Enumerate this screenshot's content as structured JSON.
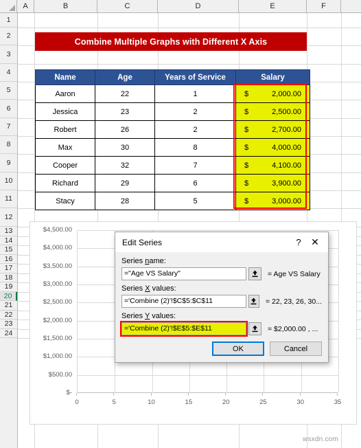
{
  "spreadsheet": {
    "column_headers": [
      "A",
      "B",
      "C",
      "D",
      "E",
      "F"
    ],
    "row_headers": [
      "1",
      "2",
      "3",
      "4",
      "5",
      "6",
      "7",
      "8",
      "9",
      "10",
      "11",
      "12",
      "13",
      "14",
      "15",
      "16",
      "17",
      "18",
      "19",
      "20",
      "21",
      "22",
      "23",
      "24"
    ],
    "selected_row": "20",
    "colors": {
      "header_fill": "#f0f0f0",
      "gridline": "#d8d8d8",
      "selection_green": "#0d7a42"
    }
  },
  "banner": {
    "text": "Combine Multiple Graphs with Different X Axis",
    "fill": "#c00000",
    "text_color": "#ffffff"
  },
  "table": {
    "headers": [
      "Name",
      "Age",
      "Years of Service",
      "Salary"
    ],
    "header_fill": "#2e5395",
    "highlight_fill": "#e8f000",
    "outline_color": "#ff0000",
    "currency_symbol": "$",
    "rows": [
      {
        "name": "Aaron",
        "age": "22",
        "years": "1",
        "salary": "2,000.00"
      },
      {
        "name": "Jessica",
        "age": "23",
        "years": "2",
        "salary": "2,500.00"
      },
      {
        "name": "Robert",
        "age": "26",
        "years": "2",
        "salary": "2,700.00"
      },
      {
        "name": "Max",
        "age": "30",
        "years": "8",
        "salary": "4,000.00"
      },
      {
        "name": "Cooper",
        "age": "32",
        "years": "7",
        "salary": "4,100.00"
      },
      {
        "name": "Richard",
        "age": "29",
        "years": "6",
        "salary": "3,900.00"
      },
      {
        "name": "Stacy",
        "age": "28",
        "years": "5",
        "salary": "3,000.00"
      }
    ]
  },
  "chart_data": {
    "type": "scatter",
    "title": "",
    "xlabel": "",
    "ylabel": "",
    "x_ticks": [
      "0",
      "5",
      "10",
      "15",
      "20",
      "25",
      "30",
      "35"
    ],
    "y_ticks": [
      "$4,500.00",
      "$4,000.00",
      "$3,500.00",
      "$3,000.00",
      "$2,500.00",
      "$2,000.00",
      "$1,500.00",
      "$1,000.00",
      "$500.00",
      "$-"
    ],
    "xlim": [
      0,
      35
    ],
    "ylim": [
      0,
      4500
    ],
    "grid": true,
    "legend": "none",
    "series": [
      {
        "name": "Age VS Salary",
        "x": [
          22,
          23,
          26,
          30,
          32,
          29,
          28
        ],
        "y": [
          2000,
          2500,
          2700,
          4000,
          4100,
          3900,
          3000
        ]
      }
    ]
  },
  "dialog": {
    "title": "Edit Series",
    "help_icon": "?",
    "close_icon": "✕",
    "fields": [
      {
        "label_pre": "Series ",
        "label_key": "n",
        "label_post": "ame:",
        "value": "=\"Age VS Salary\"",
        "preview": "= Age VS Salary",
        "highlighted": false,
        "collapse_icon": "range-selector-icon"
      },
      {
        "label_pre": "Series ",
        "label_key": "X",
        "label_post": " values:",
        "value": "='Combine (2)'!$C$5:$C$11",
        "preview": "= 22, 23, 26, 30...",
        "highlighted": false,
        "collapse_icon": "range-selector-icon"
      },
      {
        "label_pre": "Series ",
        "label_key": "Y",
        "label_post": " values:",
        "value": "='Combine (2)'!$E$5:$E$11",
        "preview": "=  $2,000.00 ,  ...",
        "highlighted": true,
        "collapse_icon": "range-selector-icon"
      }
    ],
    "ok_label": "OK",
    "cancel_label": "Cancel",
    "default_button": "OK",
    "focus_color": "#0078d7"
  },
  "watermark": {
    "text": "wsxdn.com"
  }
}
